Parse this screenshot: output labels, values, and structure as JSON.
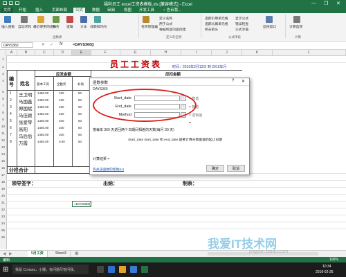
{
  "window": {
    "title": "福利员工 excel工资表模板.xls [兼容模式] - Excel",
    "minimize": "—",
    "restore": "❐",
    "close": "✕"
  },
  "ribbon": {
    "tabs": [
      "文件",
      "开始",
      "插入",
      "页面布局",
      "公式",
      "数据",
      "审阅",
      "视图",
      "开发工具"
    ],
    "active_tab": "公式",
    "tell_me": "♀ 告诉我...",
    "groups": {
      "function_library": "函数库",
      "defined_names": "定义的名称",
      "formula_auditing": "公式审核",
      "calculation": "计算"
    },
    "buttons": {
      "insert_function": "插入函数",
      "autosum": "自动求和",
      "recent": "最近使用的函数",
      "financial": "财务",
      "logical": "逻辑",
      "text": "文本",
      "datetime": "日期和时间",
      "name_manager": "名称管理器",
      "define_name": "定义名称",
      "use_in_formula": "用于公式",
      "create_from_selection": "根据所选内容创建",
      "trace_precedents": "追踪引用单元格",
      "trace_dependents": "追踪从属单元格",
      "remove_arrows": "移去箭头",
      "show_formulas": "显示公式",
      "error_check": "错误检查",
      "evaluate": "公式求值",
      "watch": "监视窗口",
      "calc_options": "计算选项"
    }
  },
  "formula_bar": {
    "name_box": "DAYS360",
    "cancel": "✕",
    "enter": "✓",
    "fx": "fx",
    "formula": "=DAYS360()"
  },
  "grid": {
    "columns": [
      "A",
      "B",
      "C",
      "D",
      "E",
      "F",
      "G",
      "H",
      "I",
      "J",
      "K",
      "L"
    ],
    "rows": [
      "1",
      "2",
      "3",
      "4",
      "5",
      "6",
      "7",
      "8",
      "9",
      "10",
      "11",
      "12",
      "13",
      "14",
      "15",
      "16",
      "17",
      "18",
      "19",
      "20",
      "21",
      "22",
      "23",
      "24",
      "25",
      "26"
    ],
    "title": "员工工资表",
    "date_label": "时间：2015年2月12日 到 2015年月",
    "header_should": "应发金额",
    "header_deduct": "应扣金额",
    "header_no": "编号",
    "header_name": "姓名",
    "sub_base": "基本工资",
    "sub_bonus": "全勤奖",
    "sub_allow": "补助",
    "employees": [
      {
        "no": "1",
        "name": "王卫明",
        "base": "1450.00",
        "bonus": "100",
        "allow": "50"
      },
      {
        "no": "2",
        "name": "马国鑫",
        "base": "1450.00",
        "bonus": "100",
        "allow": "50"
      },
      {
        "no": "3",
        "name": "郑国斌",
        "base": "1450.00",
        "bonus": "100",
        "allow": "50"
      },
      {
        "no": "4",
        "name": "马佳颖",
        "base": "1450.00",
        "bonus": "100",
        "allow": "50"
      },
      {
        "no": "5",
        "name": "张爱琴",
        "base": "1450.00",
        "bonus": "100",
        "allow": "50"
      },
      {
        "no": "6",
        "name": "高阳",
        "base": "1450.00",
        "bonus": "100",
        "allow": "50"
      },
      {
        "no": "7",
        "name": "马后后",
        "base": "1450.00",
        "bonus": "100",
        "allow": "50"
      },
      {
        "no": "8",
        "name": "万霞",
        "base": "1450.00",
        "bonus": "0.00",
        "allow": "50"
      }
    ],
    "subtotal": "分栏合计",
    "sign_leader": "领导签字：",
    "sign_cashier": "出纳：",
    "sign_maker": "制表：",
    "active_cell_text": "=DAYS360()"
  },
  "dialog": {
    "title": "函数参数",
    "help": "?",
    "close": "✕",
    "function_name": "DAYS360",
    "args": [
      {
        "label": "Start_date",
        "value": "= 数值"
      },
      {
        "label": "End_date",
        "value": "= 数值"
      },
      {
        "label": "Method",
        "value": "= 逻辑值"
      }
    ],
    "result_eq": "=",
    "description": "按每年 360 天返回两个日期间相差的天数(每月 30 天)",
    "arg_help": "Start_date  start_date 和 end_date 是要计算天数差值的起止日期",
    "calc_result": "计算结果 =",
    "help_link": "有关该函数的帮助(H)",
    "ok": "确定",
    "cancel": "取消"
  },
  "sheet_tabs": {
    "tabs": [
      "5月工资",
      "Sheet3"
    ],
    "add": "⊕",
    "active": "5月工资"
  },
  "statusbar": {
    "mode": "编辑",
    "zoom": "100%"
  },
  "taskbar": {
    "search": "我是 Cortana，小娜。有问题尽管问我。",
    "time": "10:34",
    "date": "2016-02-26"
  },
  "watermark": {
    "text": "我爱IT技术网",
    "url": "jingyan.baidu.com"
  },
  "colors": {
    "excel_green": "#217346",
    "dialog_highlight": "#d9221f",
    "title_red": "#c00000"
  }
}
